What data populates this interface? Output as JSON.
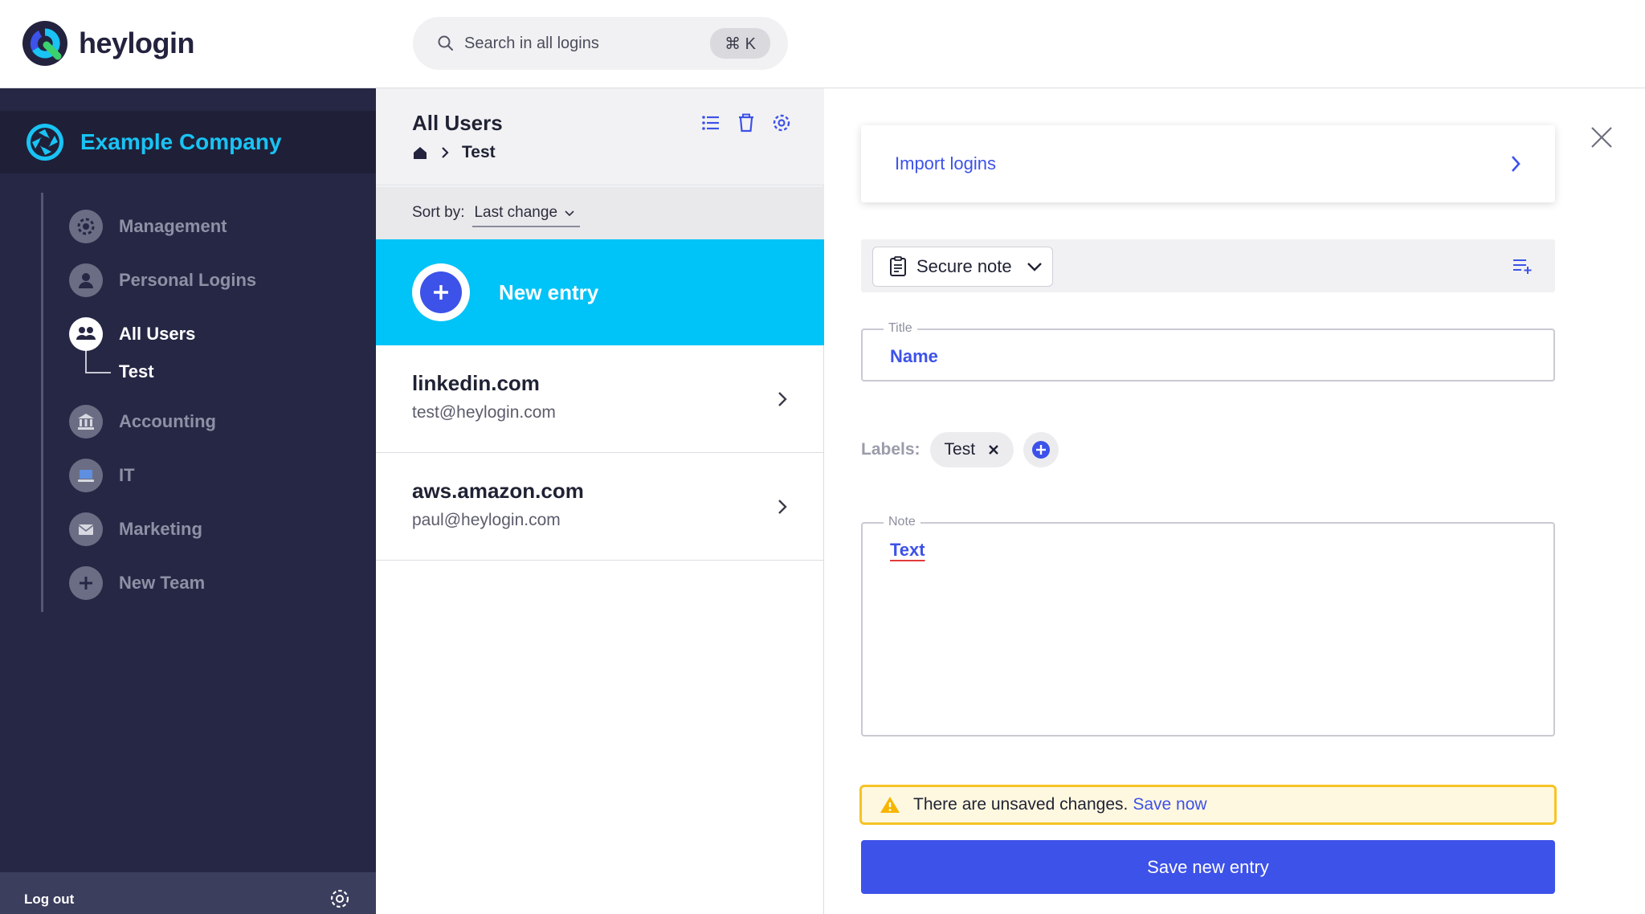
{
  "app": {
    "brand_name": "heylogin"
  },
  "search": {
    "placeholder": "Search in all logins",
    "shortcut": "⌘ K"
  },
  "sidebar": {
    "company_name": "Example Company",
    "items": [
      {
        "label": "Management",
        "icon": "gear-icon",
        "active": false
      },
      {
        "label": "Personal Logins",
        "icon": "person-icon",
        "active": false
      },
      {
        "label": "All Users",
        "icon": "users-icon",
        "active": true
      },
      {
        "label": "Accounting",
        "icon": "bank-icon",
        "active": false
      },
      {
        "label": "IT",
        "icon": "laptop-icon",
        "active": false
      },
      {
        "label": "Marketing",
        "icon": "envelope-icon",
        "active": false
      },
      {
        "label": "New Team",
        "icon": "plus-icon",
        "active": false
      }
    ],
    "sub_item": "Test",
    "logout_label": "Log out"
  },
  "middle": {
    "title": "All Users",
    "breadcrumb_current": "Test",
    "sort_label": "Sort by:",
    "sort_value": "Last change",
    "new_entry_label": "New entry",
    "entries": [
      {
        "title": "linkedin.com",
        "subtitle": "test@heylogin.com"
      },
      {
        "title": "aws.amazon.com",
        "subtitle": "paul@heylogin.com"
      }
    ]
  },
  "editor": {
    "import_label": "Import logins",
    "type_label": "Secure note",
    "title_legend": "Title",
    "title_value": "Name",
    "labels_title": "Labels:",
    "label_chip": "Test",
    "note_legend": "Note",
    "note_value": "Text",
    "warning_text": "There are unsaved changes.",
    "warning_link": "Save now",
    "save_button": "Save new entry"
  },
  "colors": {
    "accent": "#3d52e8",
    "cyan": "#00c3f7",
    "sidebar_bg": "#262744",
    "warning_border": "#f7c325"
  }
}
